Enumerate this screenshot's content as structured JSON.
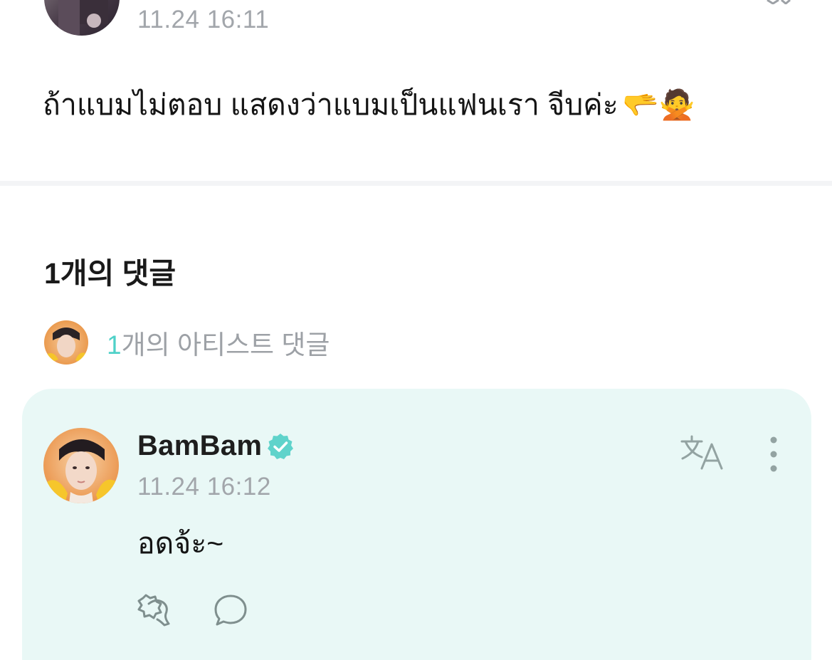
{
  "post": {
    "time": "11.24 16:11",
    "body": "ถ้าแบมไม่ตอบ แสดงว่าแบมเป็นแฟนเรา  จีบค่ะ",
    "emoji": "🫳🙅"
  },
  "comments_section": {
    "count_label": "1개의 댓글",
    "artist_count_number": "1",
    "artist_count_label": "개의 아티스트 댓글"
  },
  "comment": {
    "author": "BamBam",
    "time": "11.24 16:12",
    "text": "อดจ้ะ~"
  },
  "icons": {
    "verified": "verified-badge-icon",
    "translate": "translate-icon",
    "more": "more-vertical-icon",
    "like": "cheer-like-icon",
    "reply": "reply-bubble-icon"
  },
  "colors": {
    "accent": "#4fd1c8",
    "card_background": "#e9f8f6",
    "muted_text": "#a2a6ab",
    "divider": "#f3f4f6"
  }
}
